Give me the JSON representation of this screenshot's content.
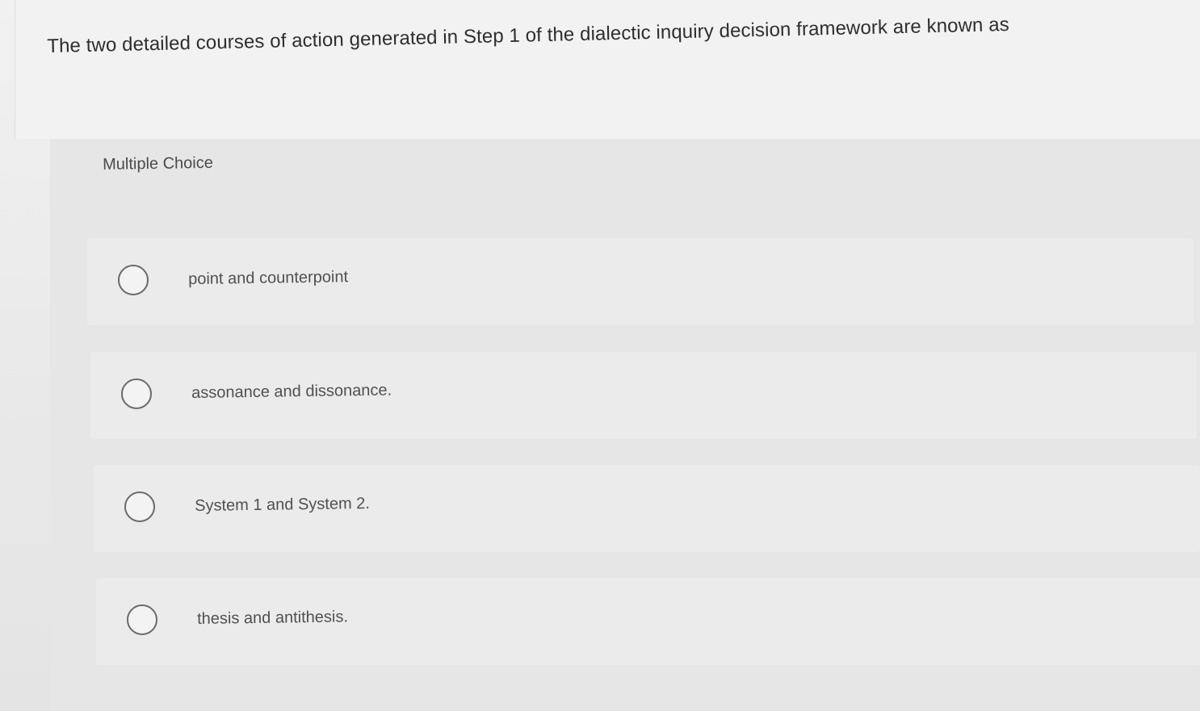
{
  "question": {
    "text": "The two detailed courses of action generated in Step 1 of the dialectic inquiry decision framework are known as"
  },
  "question_type_label": "Multiple Choice",
  "options": [
    {
      "label": "point and counterpoint",
      "selected": false
    },
    {
      "label": "assonance and dissonance.",
      "selected": false
    },
    {
      "label": "System 1 and System 2.",
      "selected": false
    },
    {
      "label": "thesis and antithesis.",
      "selected": false
    }
  ],
  "colors": {
    "background": "#ededed",
    "panel": "#e6e6e6",
    "radio_border": "#6a6a6a",
    "text": "#3a3a3a"
  }
}
